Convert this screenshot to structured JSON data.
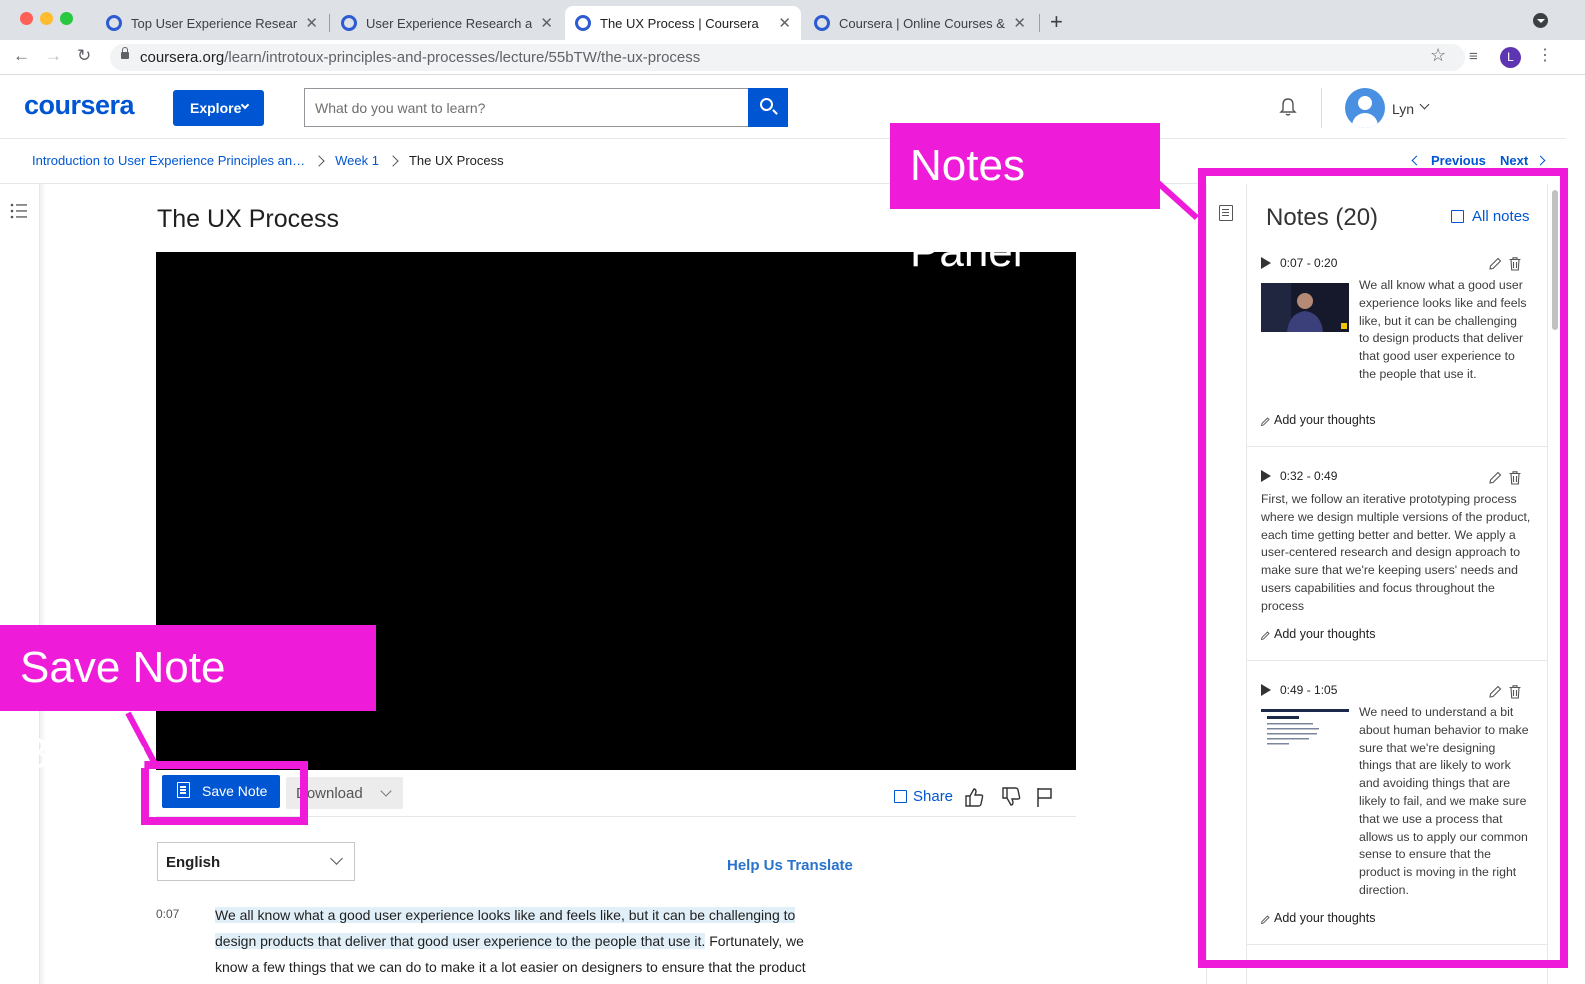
{
  "browser": {
    "tabs": [
      {
        "title": "Top User Experience Research"
      },
      {
        "title": "User Experience Research and"
      },
      {
        "title": "The UX Process | Coursera"
      },
      {
        "title": "Coursera | Online Courses & Cr"
      }
    ],
    "url_host": "coursera.org",
    "url_path": "/learn/introtoux-principles-and-processes/lecture/55bTW/the-ux-process",
    "profile_initial": "L"
  },
  "header": {
    "logo": "coursera",
    "explore_label": "Explore",
    "search_placeholder": "What do you want to learn?",
    "username": "Lyn"
  },
  "breadcrumb": {
    "course": "Introduction to User Experience Principles an…",
    "week": "Week 1",
    "current": "The UX Process",
    "previous_label": "Previous",
    "next_label": "Next"
  },
  "lecture": {
    "title": "The UX Process",
    "save_note_label": "Save Note",
    "download_label": "Download",
    "share_label": "Share",
    "language": "English",
    "help_translate": "Help Us Translate",
    "transcript_time": "0:07",
    "transcript_highlight": "We all know what a good user experience looks like and feels like, but it can be challenging to design products that deliver that good user experience to the people that use it.",
    "transcript_rest": " Fortunately, we know a few things that we can do to make it a lot easier on designers to ensure that the product"
  },
  "notes": {
    "title": "Notes (20)",
    "all_notes_label": "All notes",
    "add_thoughts_label": "Add your thoughts",
    "items": [
      {
        "range": "0:07 - 0:20",
        "text": "We all know what a good user experience looks like and feels like, but it can be challenging to design products that deliver that good user experience to the people that use it."
      },
      {
        "range": "0:32 - 0:49",
        "text": "First, we follow an iterative prototyping process where we design multiple versions of the product, each time getting better and better. We apply a user-centered research and design approach to make sure that we're keeping users' needs and users capabilities and focus throughout the process"
      },
      {
        "range": "0:49 - 1:05",
        "text": "We need to understand a bit about human behavior to make sure that we're designing things that are likely to work and avoiding things that are likely to fail, and we make sure that we use a process that allows us to apply our common sense to ensure that the product is moving in the right direction."
      }
    ]
  },
  "annotations": {
    "notes_panel_label": "Notes Panel",
    "save_note_label": "Save Note Button",
    "color": "#ee1bd8"
  },
  "colors": {
    "brand": "#0056d2"
  }
}
